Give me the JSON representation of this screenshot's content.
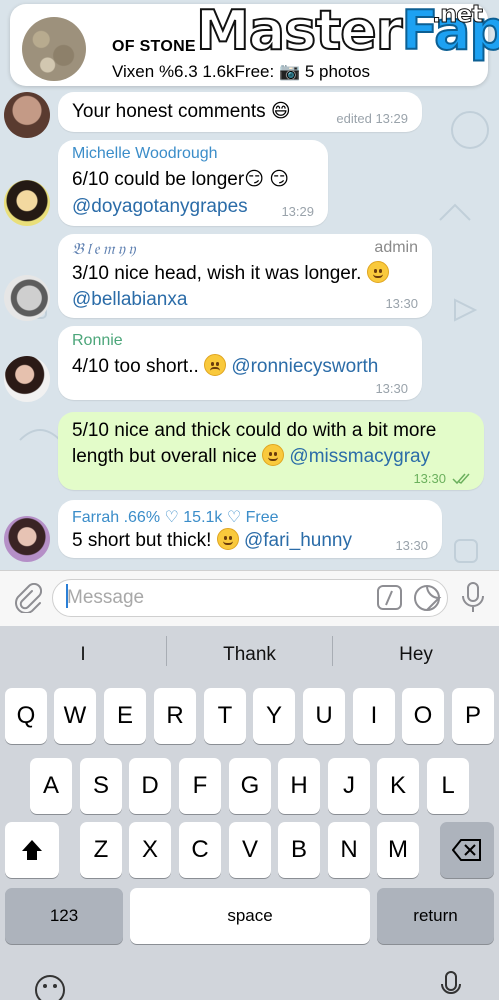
{
  "pinned": {
    "title": "OF STONE",
    "subtitle": "Vixen %6.3 1.6kFree: 📷 5 photos"
  },
  "watermark": {
    "main": "Master",
    "accent": "Fap",
    "suffix": ".net"
  },
  "messages": [
    {
      "text": "Your honest comments 😄",
      "time": "edited 13:29"
    },
    {
      "sender": "Michelle Woodrough",
      "line1": "6/10 could be longer😏 😏",
      "mention": "@doyagotanygrapes",
      "time": "13:29"
    },
    {
      "sender": "𝔅𝔩𝔢𝔪𝔶𝔶",
      "role": "admin",
      "line1": "3/10 nice head, wish it was longer.",
      "mention": "@bellabianxa",
      "time": "13:30"
    },
    {
      "sender": "Ronnie",
      "line1": "4/10 too short..",
      "mention": "@ronniecysworth",
      "time": "13:30"
    },
    {
      "line1": "5/10 nice and thick could do with a bit more",
      "line2": "length but overall nice",
      "mention": "@missmacygray",
      "time": "13:30"
    },
    {
      "sender": "Farrah .66% ♡ 15.1k ♡ Free",
      "line1": "5 short but thick!",
      "mention": "@fari_hunny",
      "time": "13:30"
    }
  ],
  "input": {
    "placeholder": "Message"
  },
  "keyboard": {
    "suggestions": [
      "I",
      "Thank",
      "Hey"
    ],
    "row1": [
      "Q",
      "W",
      "E",
      "R",
      "T",
      "Y",
      "U",
      "I",
      "O",
      "P"
    ],
    "row2": [
      "A",
      "S",
      "D",
      "F",
      "G",
      "H",
      "J",
      "K",
      "L"
    ],
    "row3": [
      "Z",
      "X",
      "C",
      "V",
      "B",
      "N",
      "M"
    ],
    "numbers": "123",
    "space": "space",
    "return": "return"
  },
  "colors": {
    "sender_blue": "#3b8dc9",
    "sender_green": "#4ca67a",
    "outgoing": "#e3fcc9",
    "mention": "#2b6ca8"
  }
}
